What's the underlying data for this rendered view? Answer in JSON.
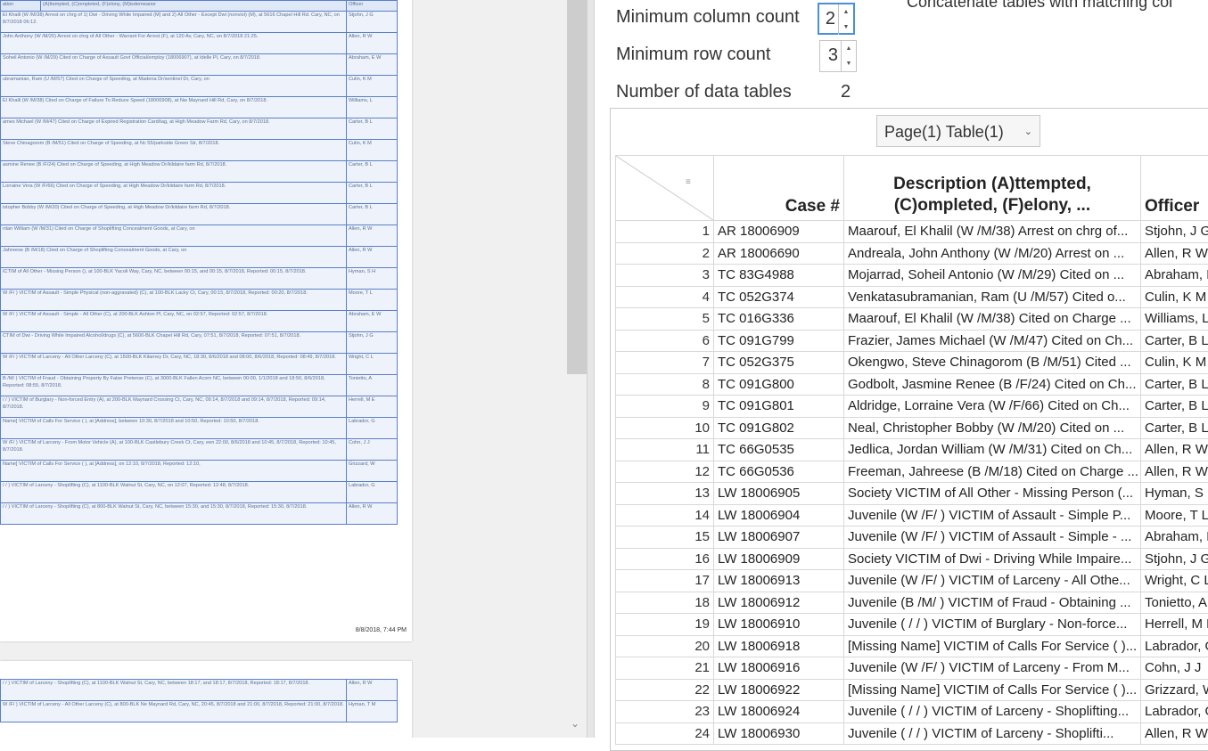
{
  "preview": {
    "page1_header": [
      "ation",
      "(A)ttempted, (C)ompleted, (F)elony, (M)isdemeanor",
      "Officer"
    ],
    "page1_rows": [
      [
        "El Khalil (W /M/38) Arrest on chrg of 1) Dwi - Driving While Impaired (M) and 2) All Other - Except Dwi (nonviol) (M), at 5616 Chapel Hill Rd. Cary, NC, on 8/7/2018 06:12.",
        "Stjohn, J G"
      ],
      [
        "John Anthony (W /M/20) Arrest on chrg of All Other - Warrant For Arrest (F), at 120 Av, Cary, NC, on 8/7/2018 21:25.",
        "Allen, R W"
      ],
      [
        "Soheil Antonio (W /M/29) Cited on Charge of Assault Govt Official/employ (18006907), at Idelle Pl, Cary, on 8/7/2018.",
        "Abraham, E W"
      ],
      [
        "ubramanian, Ram (U /M/57) Cited on Charge of Speeding, at Madena Dr/sentinel Dr, Cary, on",
        "Culin, K M"
      ],
      [
        "El Khalil (W /M/38) Cited on Charge of Failure To Reduce Speed (18006908), at Nw Maynard Hill Rd, Cary, on 8/7/2018.",
        "Williams, L"
      ],
      [
        "ames Michael (W /M/47) Cited on Charge of Expired Registration Card/tag, at High Meadow Farm Rd, Cary, on 8/7/2018.",
        "Carter, B L"
      ],
      [
        "Steve Chinagorom (B /M/51) Cited on Charge of Speeding, at Nc 55/parkside Green Str, 8/7/2018.",
        "Culin, K M"
      ],
      [
        "asmine Renee (B /F/24) Cited on Charge of Speeding, at High Meadow Dr/kildaire farm Rd, 8/7/2018.",
        "Carter, B L"
      ],
      [
        "Lorraine Vera (W /F/66) Cited on Charge of Speeding, at High Meadow Dr/kildaire farm Rd, 8/7/2018.",
        "Carter, B L"
      ],
      [
        "istopher Bobby (W /M/20) Cited on Charge of Speeding, at High Meadow Dr/kildaire farm Rd, 8/7/2018.",
        "Carter, B L"
      ],
      [
        "rdan William (W /M/31) Cited on Charge of Shoplifting Concealment Goods, at Cary, on",
        "Allen, R W"
      ],
      [
        "Jahreese (B /M/18) Cited on Charge of Shoplifting Concealment Goods, at Cary, on",
        "Allen, R W"
      ],
      [
        "ICTIM of All Other - Missing Person (), at 100-BLK Yacoli Way, Cary, NC, between 00:15, and 00:15, 8/7/2018, Reported: 00:15, 8/7/2018.",
        "Hyman, S H"
      ],
      [
        "W /F/ ) VICTIM of Assault - Simple Physical (non-aggravated) (C), at 100-BLK Lacky Ct, Cary, 00:15, 8/7/2018, Reported: 00:20, 8/7/2018.",
        "Moore, T L"
      ],
      [
        "W /F/ ) VICTIM of Assault - Simple - All Other (C), at 200-BLK Ashton Pl, Cary, NC, on 02:57, Reported: 02:57, 8/7/2018.",
        "Abraham, E W"
      ],
      [
        "CTIM of Dwi - Driving While Impaired Alcohol/drugs (C), at 5600-BLK Chapel Hill Rd, Cary, 07:51, 8/7/2018, Reported: 07:51, 8/7/2018.",
        "Stjohn, J G"
      ],
      [
        "W /F/ ) VICTIM of Larceny - All Other Larceny (C), at 1500-BLK Kilarney Dr, Cary, NC, 18:30, 8/6/2018 and 08:00, 8/6/2018, Reported: 08:49, 8/7/2018.",
        "Wright, C L"
      ],
      [
        "B /M/ ) VICTIM of Fraud - Obtaining Property By False Pretense (C), at 3000-BLK Fallen Acorn NC, between 00:00, 1/1/2018 and 18:50, 8/6/2018, Reported: 08:55, 8/7/2018.",
        "Tonietto, A"
      ],
      [
        "/ / ) VICTIM of Burglary - Non-forced Entry (A), at 200-BLK Maynard Crossing Ct, Cary, NC, 09:14, 8/7/2018 and 09:14, 8/7/2018, Reported: 09:14, 8/7/2018.",
        "Herrell, M E"
      ],
      [
        "Name] VICTIM of Calls For Service ( ), at [Address], between 10:30, 8/7/2018 and 10:50, Reported: 10:50, 8/7/2018.",
        "Labrador, G"
      ],
      [
        "W /F/ ) VICTIM of Larceny - From Motor Vehicle (A), at 100-BLK Castlebury Creek Ct, Cary, een 22:00, 8/6/2018 and 10:45, 8/7/2018, Reported: 10:45, 8/7/2018.",
        "Cohn, J J"
      ],
      [
        "Name] VICTIM of Calls For Service ( ), at [Address], on 12:10, 8/7/2018, Reported: 12:10,",
        "Grizzard, W"
      ],
      [
        "/ / ) VICTIM of Larceny - Shoplifting (C), at 1100-BLK Walnut St, Cary, NC, on 12:07, Reported: 12:48, 8/7/2018.",
        "Labrador, G"
      ],
      [
        "/ / ) VICTIM of Larceny - Shoplifting (C), at 800-BLK Walnut St, Cary, NC, between 15:30, and 15:30, 8/7/2018, Reported: 15:30, 8/7/2018.",
        "Allen, R W"
      ]
    ],
    "page1_date": "8/8/2018, 7:44 PM",
    "page2_rows": [
      [
        "/ / ) VICTIM of Larceny - Shoplifting (C), at 1100-BLK Walnut St, Cary, NC, between 18:17, and 18:17, 8/7/2018, Reported: 18:17, 8/7/2018.",
        "Allen, R W"
      ],
      [
        "W /F/ ) VICTIM of Larceny - All Other Larceny (C), at 800-BLK Ne Maynard Rd, Cary, NC, 20:45, 8/7/2018 and 21:00, 8/7/2018, Reported: 21:00, 8/7/2018.",
        "Hyman, T M"
      ]
    ]
  },
  "settings": {
    "concat_label": "Concatenate tables with matching col",
    "min_col_label": "Minimum column count",
    "min_col_value": "2",
    "min_row_label": "Minimum row count",
    "min_row_value": "3",
    "num_tables_label": "Number of data tables",
    "num_tables_value": "2"
  },
  "table_selector": {
    "value": "Page(1)  Table(1)"
  },
  "grid": {
    "headers": [
      "Case #",
      "Description (A)ttempted, (C)ompleted, (F)elony, ...",
      "Officer"
    ],
    "rows": [
      [
        "1",
        "AR 18006909",
        "Maarouf, El Khalil (W /M/38) Arrest on chrg of...",
        "Stjohn, J G"
      ],
      [
        "2",
        "AR 18006690",
        "Andreala, John Anthony (W /M/20) Arrest on ...",
        "Allen, R W"
      ],
      [
        "3",
        "TC 83G4988",
        "Mojarrad, Soheil Antonio (W /M/29) Cited on ...",
        "Abraham, E"
      ],
      [
        "4",
        "TC 052G374",
        "Venkatasubramanian, Ram (U /M/57) Cited o...",
        "Culin, K M"
      ],
      [
        "5",
        "TC 016G336",
        "Maarouf, El Khalil (W /M/38) Cited on Charge ...",
        "Williams, L"
      ],
      [
        "6",
        "TC 091G799",
        "Frazier, James Michael (W /M/47) Cited on Ch...",
        "Carter, B L"
      ],
      [
        "7",
        "TC 052G375",
        "Okengwo, Steve Chinagorom (B /M/51) Cited ...",
        "Culin, K M"
      ],
      [
        "8",
        "TC 091G800",
        "Godbolt, Jasmine Renee (B /F/24) Cited on Ch...",
        "Carter, B L"
      ],
      [
        "9",
        "TC 091G801",
        "Aldridge, Lorraine Vera (W /F/66) Cited on Ch...",
        "Carter, B L"
      ],
      [
        "10",
        "TC 091G802",
        "Neal, Christopher Bobby (W /M/20) Cited on ...",
        "Carter, B L"
      ],
      [
        "11",
        "TC 66G0535",
        "Jedlica, Jordan William (W /M/31) Cited on Ch...",
        "Allen, R W"
      ],
      [
        "12",
        "TC 66G0536",
        "Freeman, Jahreese (B /M/18) Cited on Charge ...",
        "Allen, R W"
      ],
      [
        "13",
        "LW 18006905",
        "Society VICTIM of All Other - Missing Person (...",
        "Hyman, S H"
      ],
      [
        "14",
        "LW 18006904",
        "Juvenile (W /F/ ) VICTIM of Assault - Simple P...",
        "Moore, T L"
      ],
      [
        "15",
        "LW 18006907",
        "Juvenile (W /F/ ) VICTIM of Assault - Simple - ...",
        "Abraham, E"
      ],
      [
        "16",
        "LW 18006909",
        "Society VICTIM of Dwi - Driving While Impaire...",
        "Stjohn, J G"
      ],
      [
        "17",
        "LW 18006913",
        "Juvenile (W /F/ ) VICTIM of Larceny - All Othe...",
        "Wright, C L"
      ],
      [
        "18",
        "LW 18006912",
        "Juvenile (B /M/ ) VICTIM of Fraud - Obtaining ...",
        "Tonietto, A"
      ],
      [
        "19",
        "LW 18006910",
        "Juvenile ( / / ) VICTIM of Burglary - Non-force...",
        "Herrell, M E"
      ],
      [
        "20",
        "LW 18006918",
        "[Missing Name] VICTIM of Calls For Service ( )...",
        "Labrador, G"
      ],
      [
        "21",
        "LW 18006916",
        "Juvenile (W /F/ ) VICTIM of Larceny - From M...",
        "Cohn, J J"
      ],
      [
        "22",
        "LW 18006922",
        "[Missing Name] VICTIM of Calls For Service ( )...",
        "Grizzard, W"
      ],
      [
        "23",
        "LW 18006924",
        "Juvenile ( / / ) VICTIM of Larceny - Shoplifting...",
        "Labrador, G"
      ],
      [
        "24",
        "LW 18006930",
        "Juvenile ( / / ) VICTIM of Larceny - Shoplifti...",
        "Allen, R W"
      ]
    ]
  }
}
